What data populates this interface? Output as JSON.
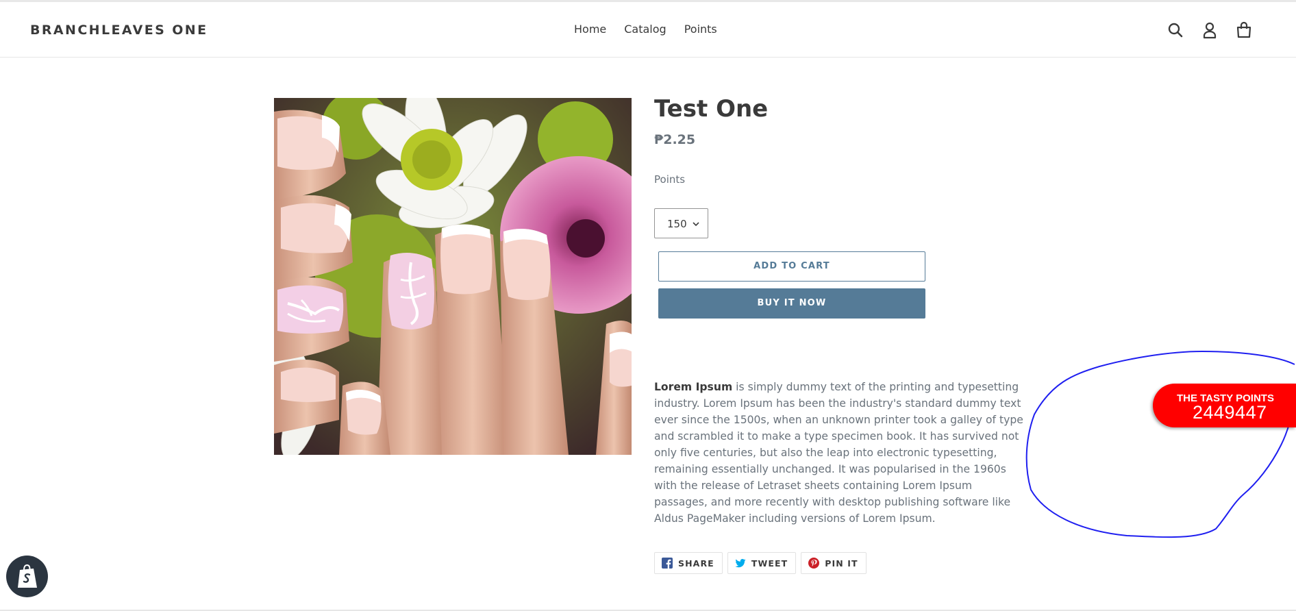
{
  "header": {
    "brand": "BRANCHLEAVES ONE",
    "nav": [
      "Home",
      "Catalog",
      "Points"
    ],
    "icons": [
      "search-icon",
      "account-icon",
      "cart-icon"
    ]
  },
  "product": {
    "title": "Test One",
    "price": "₱2.25",
    "option_label": "Points",
    "option_selected": "150",
    "add_to_cart": "ADD TO CART",
    "buy_now": "BUY IT NOW",
    "description_bold": "Lorem Ipsum",
    "description_rest": " is simply dummy text of the printing and typesetting industry. Lorem Ipsum has been the industry's standard dummy text ever since the 1500s, when an unknown printer took a galley of type and scrambled it to make a type specimen book. It has survived not only five centuries, but also the leap into electronic typesetting, remaining essentially unchanged. It was popularised in the 1960s with the release of Letraset sheets containing Lorem Ipsum passages, and more recently with desktop publishing software like Aldus PageMaker including versions of Lorem Ipsum."
  },
  "share": {
    "facebook": "SHARE",
    "twitter": "TWEET",
    "pinterest": "PIN IT"
  },
  "tasty_points": {
    "title": "THE TASTY POINTS",
    "value": "2449447"
  },
  "colors": {
    "accent": "#557b97",
    "badge": "#ff0000",
    "annotation": "#0000ff"
  }
}
